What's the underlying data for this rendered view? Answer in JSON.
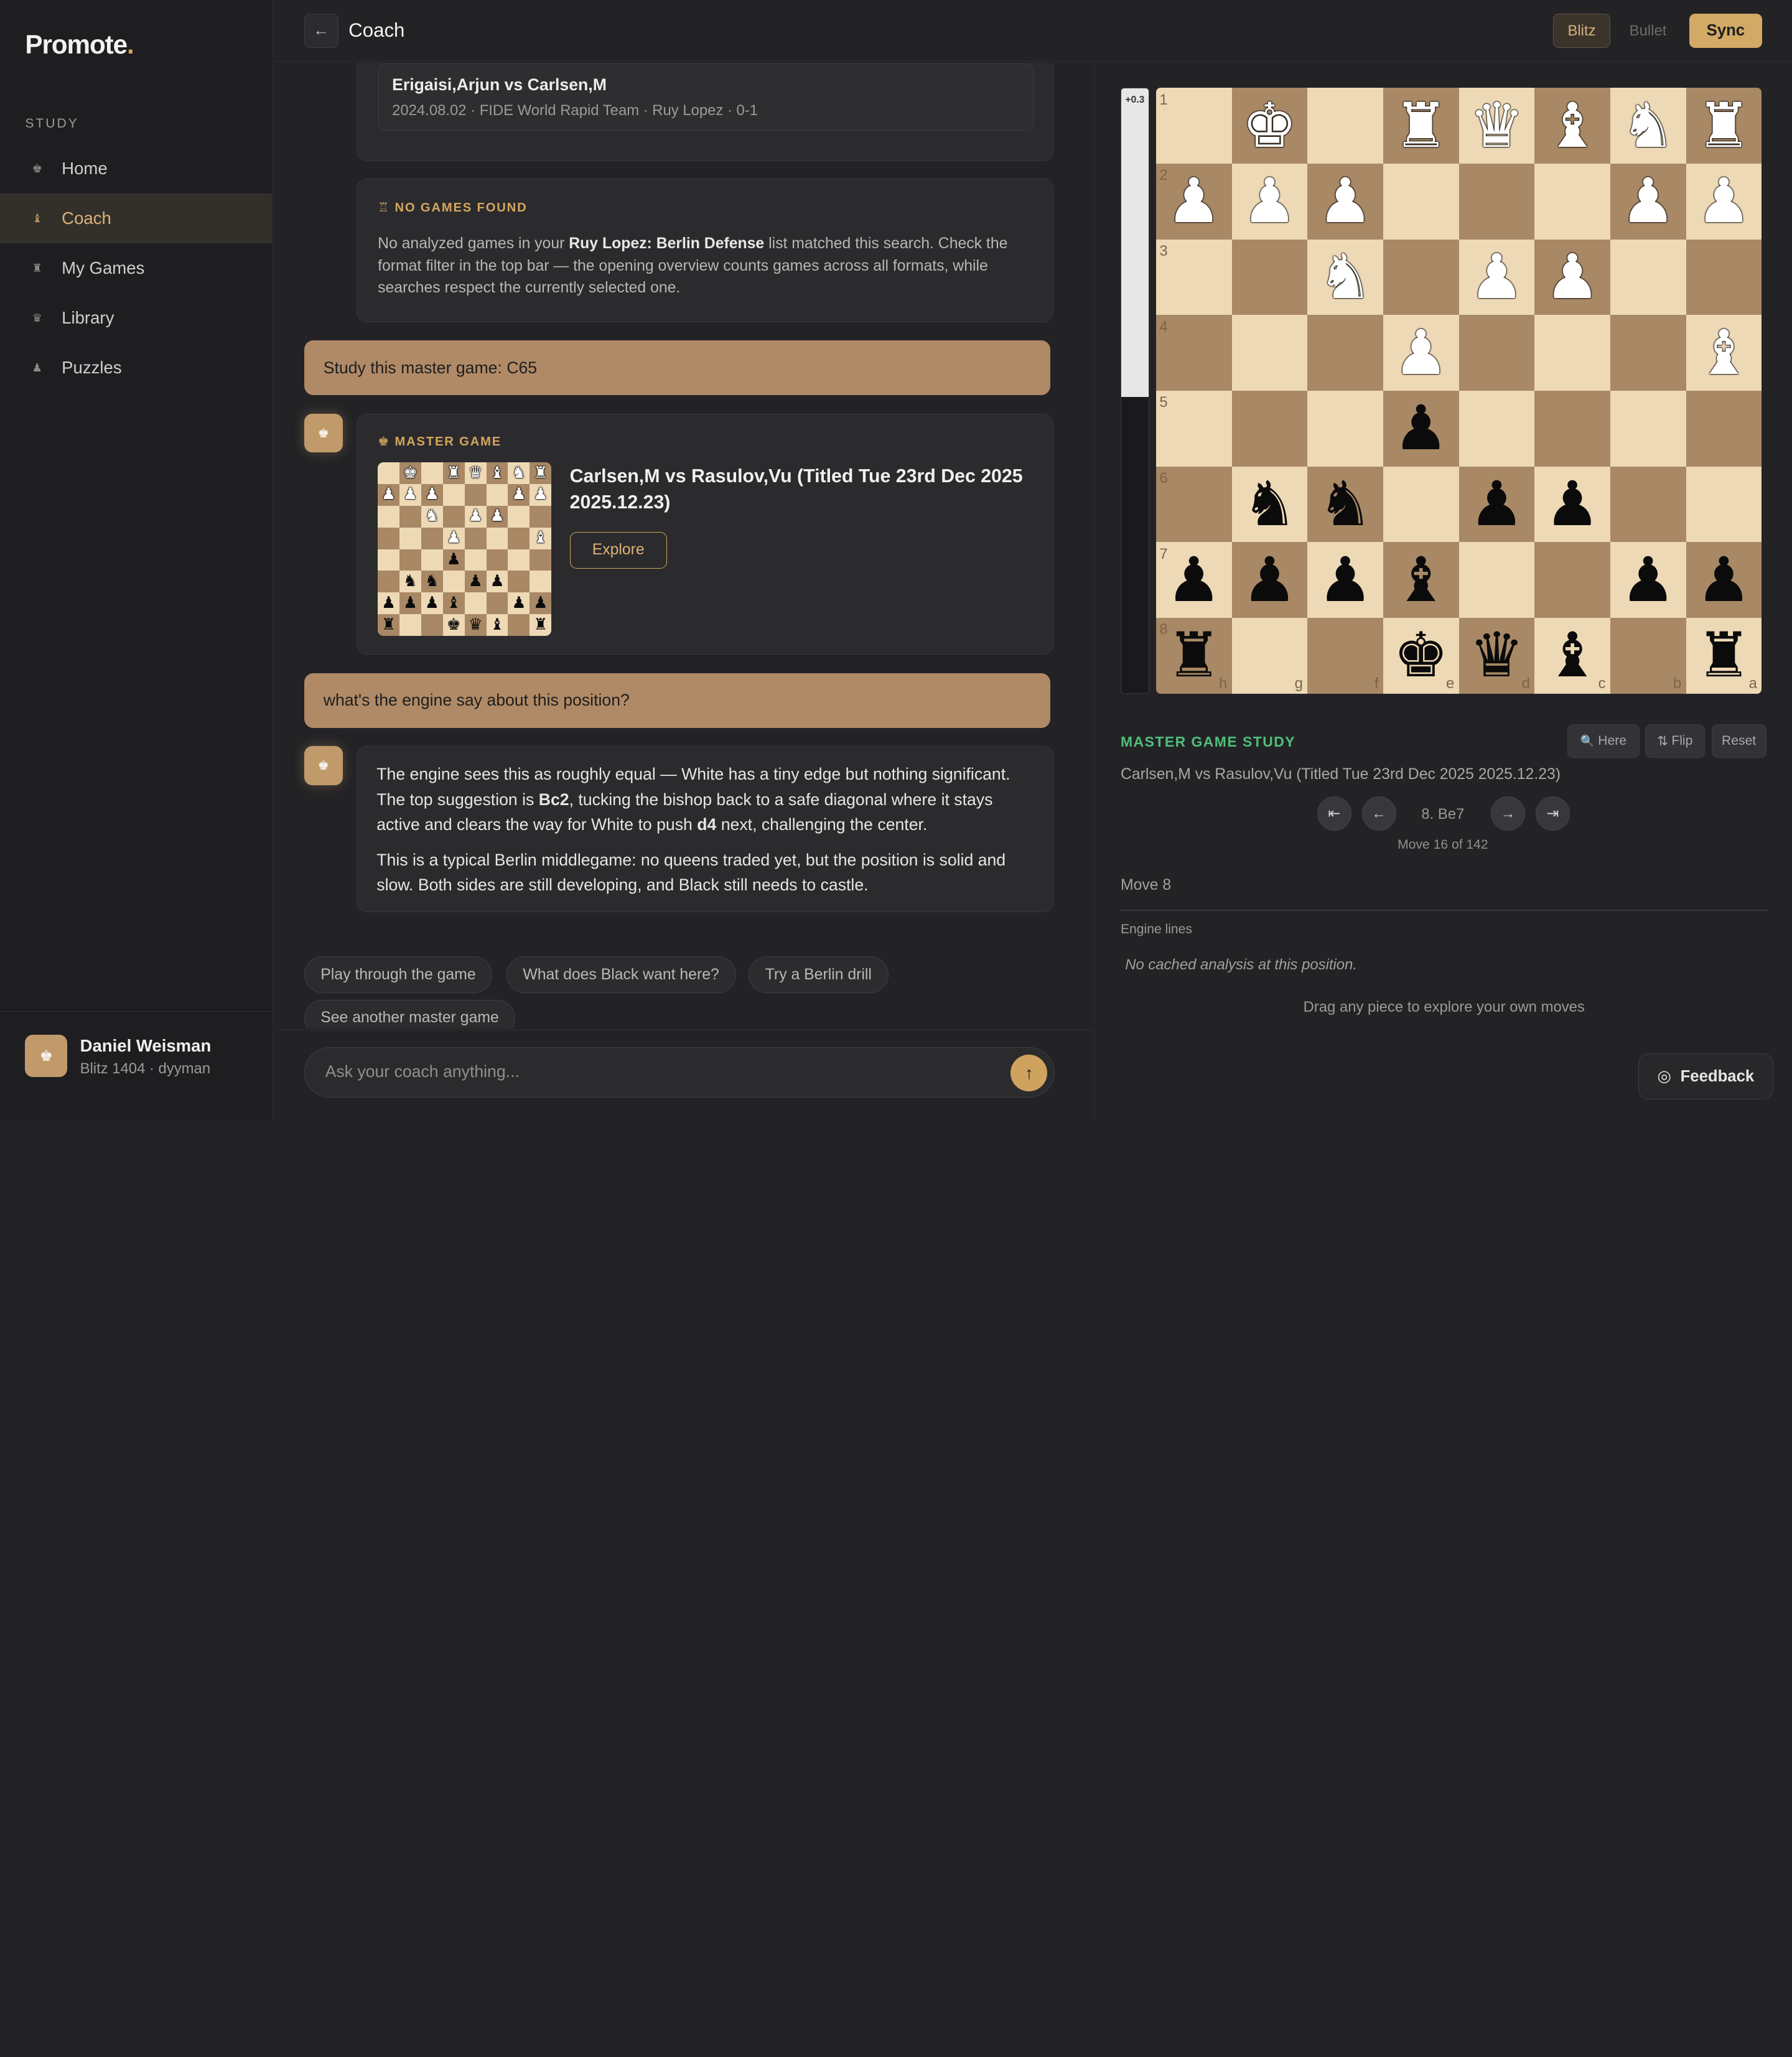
{
  "app": {
    "logo": "Promote",
    "logo_dot": "."
  },
  "sidebar": {
    "section": "STUDY",
    "items": [
      {
        "label": "Home",
        "icon": "♚",
        "active": false
      },
      {
        "label": "Coach",
        "icon": "♝",
        "active": true
      },
      {
        "label": "My Games",
        "icon": "♜",
        "active": false
      },
      {
        "label": "Library",
        "icon": "♛",
        "active": false
      },
      {
        "label": "Puzzles",
        "icon": "♟",
        "active": false
      }
    ],
    "user": {
      "name": "Daniel Weisman",
      "meta": "Blitz 1404 · dyyman",
      "avatar": "♚"
    }
  },
  "header": {
    "back": "←",
    "title": "Coach",
    "formats": [
      {
        "label": "Blitz",
        "active": true
      },
      {
        "label": "Bullet",
        "active": false
      }
    ],
    "sync": "Sync"
  },
  "chat": {
    "game_ref": {
      "title": "Erigaisi,Arjun vs Carlsen,M",
      "meta": "2024.08.02 · FIDE World Rapid Team · Ruy Lopez · 0-1"
    },
    "no_games": {
      "label_icon": "♖",
      "label": "NO GAMES FOUND",
      "text_before": "No analyzed games in your ",
      "text_bold": "Ruy Lopez: Berlin Defense",
      "text_after": " list matched this search. Check the format filter in the top bar — the opening overview counts games across all formats, while searches respect the currently selected one."
    },
    "user_msg_1": "Study this master game: C65",
    "bot_avatar": "♚",
    "master_game": {
      "label_icon": "♚",
      "label": "MASTER GAME",
      "title": "Carlsen,M vs Rasulov,Vu (Titled Tue 23rd Dec 2025 2025.12.23)",
      "explore": "Explore"
    },
    "user_msg_2": "what's the engine say about this position?",
    "answer": {
      "p1_a": "The engine sees this as roughly equal — White has a tiny edge but nothing significant. The top suggestion is ",
      "p1_b": "Bc2",
      "p1_c": ", tucking the bishop back to a safe diagonal where it stays active and clears the way for White to push ",
      "p1_d": "d4",
      "p1_e": " next, challenging the center.",
      "p2": "This is a typical Berlin middlegame: no queens traded yet, but the position is solid and slow. Both sides are still developing, and Black still needs to castle."
    },
    "suggestions": [
      "Play through the game",
      "What does Black want here?",
      "Try a Berlin drill",
      "See another master game"
    ],
    "input_placeholder": "Ask your coach anything...",
    "send_icon": "↑"
  },
  "board": {
    "eval": "+0.3",
    "eval_white_fraction": 0.51,
    "ranks": [
      "1",
      "2",
      "3",
      "4",
      "5",
      "6",
      "7",
      "8"
    ],
    "files": [
      "h",
      "g",
      "f",
      "e",
      "d",
      "c",
      "b",
      "a"
    ],
    "rows": [
      [
        "",
        "wk",
        "",
        "wr",
        "wq",
        "wb",
        "wn",
        "wr"
      ],
      [
        "wp",
        "wp",
        "wp",
        "",
        "",
        "",
        "wp",
        "wp"
      ],
      [
        "",
        "",
        "wn",
        "",
        "wp",
        "wp",
        "",
        ""
      ],
      [
        "",
        "",
        "",
        "wp",
        "",
        "",
        "",
        "wb"
      ],
      [
        "",
        "",
        "",
        "bp",
        "",
        "",
        "",
        ""
      ],
      [
        "",
        "bn",
        "bn",
        "",
        "bp",
        "bp",
        "",
        ""
      ],
      [
        "bp",
        "bp",
        "bp",
        "bb",
        "",
        "",
        "bp",
        "bp"
      ],
      [
        "br",
        "",
        "",
        "bk",
        "bq",
        "bb",
        "",
        "br"
      ]
    ]
  },
  "study": {
    "label": "MASTER GAME STUDY",
    "buttons": [
      {
        "icon": "🔍",
        "label": "Here"
      },
      {
        "icon": "⇅",
        "label": "Flip"
      },
      {
        "icon": "",
        "label": "Reset"
      }
    ],
    "game": "Carlsen,M vs Rasulov,Vu (Titled Tue 23rd Dec 2025 2025.12.23)",
    "nav": {
      "first": "⇤",
      "prev": "←",
      "next": "→",
      "last": "⇥"
    },
    "current_move": "8. Be7",
    "move_count": "Move 16 of 142",
    "move_title": "Move 8",
    "engine_label": "Engine lines",
    "no_cache": "No cached analysis at this position.",
    "hint": "Drag any piece to explore your own moves"
  },
  "feedback": {
    "icon": "◎",
    "label": "Feedback"
  }
}
